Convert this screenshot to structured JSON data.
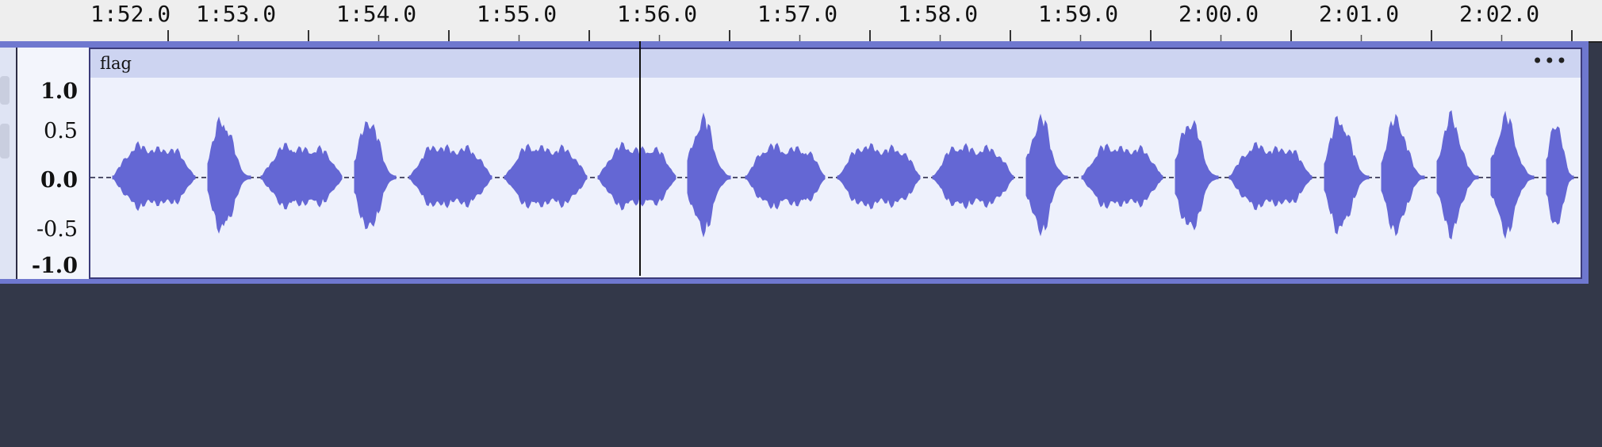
{
  "timeline": {
    "ticks": [
      "1:52.0",
      "1:53.0",
      "1:54.0",
      "1:55.0",
      "1:56.0",
      "1:57.0",
      "1:58.0",
      "1:59.0",
      "2:00.0",
      "2:01.0",
      "2:02.0"
    ]
  },
  "track": {
    "clip_name": "flag",
    "clip_menu_label": "•••",
    "amplitude_labels": [
      "1.0",
      "0.5",
      "0.0",
      "-0.5",
      "-1.0"
    ]
  },
  "colors": {
    "waveform": "#6467d4",
    "background": "#333849",
    "track_border": "#6f78cf",
    "clip_header": "#cdd4f1"
  }
}
